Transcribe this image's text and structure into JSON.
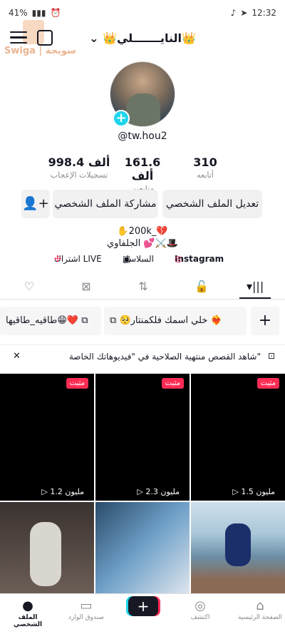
{
  "status": {
    "battery": "41%",
    "time": "12:32"
  },
  "watermark": {
    "text": "Swiga | سويجة"
  },
  "header": {
    "display_name": "👑النايـــــــلي👑",
    "chevron": "⌄"
  },
  "profile": {
    "handle": "@tw.hou2"
  },
  "stats": [
    {
      "value": "310",
      "label": "أتابعه"
    },
    {
      "value": "161.6 ألف",
      "label": "متابعين"
    },
    {
      "value": "998.4 ألف",
      "label": "تسجيلات الإعجاب"
    }
  ],
  "buttons": {
    "edit": "تعديل الملف الشخصي",
    "share": "مشاركة الملف الشخصي"
  },
  "bio": {
    "line1": "✋200k_💔",
    "line2": "الجلفاوي 💕⚔️🎩"
  },
  "links": {
    "instagram": "Instagram",
    "chains": "السلاسل",
    "live": "اشتراك LIVE"
  },
  "playlists": {
    "p1": "🥺خلي اسمك فلكمنتار ❤️‍🔥",
    "p2": "طاقيه_طاقيها😁❤️"
  },
  "notice": {
    "text": "شاهد القصص منتهية الصلاحية في \"فيديوهاتك الخاصة\""
  },
  "videos": [
    {
      "pin": "مثبت",
      "views": "▷ 1.5 مليون"
    },
    {
      "pin": "مثبت",
      "views": "▷ 2.3 مليون"
    },
    {
      "pin": "مثبت",
      "views": "▷ 1.2 مليون"
    }
  ],
  "nav": [
    {
      "label": "الصفحة الرئيسية"
    },
    {
      "label": "اكتشف"
    },
    {
      "label": "صندوق الوارد"
    },
    {
      "label": "الملف الشخصي"
    }
  ]
}
